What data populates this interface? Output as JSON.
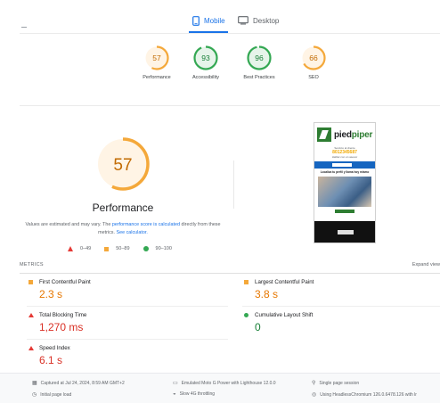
{
  "tabs": {
    "mobile": "Mobile",
    "desktop": "Desktop",
    "active": "mobile"
  },
  "scores": [
    {
      "label": "Performance",
      "value": 57,
      "color": "#f4a83a"
    },
    {
      "label": "Accessibility",
      "value": 93,
      "color": "#34a853"
    },
    {
      "label": "Best Practices",
      "value": 96,
      "color": "#34a853"
    },
    {
      "label": "SEO",
      "value": 66,
      "color": "#f4a83a"
    }
  ],
  "performance": {
    "score": 57,
    "title": "Performance",
    "note_prefix": "Values are estimated and may vary. The ",
    "note_link": "performance score is calculated",
    "note_middle": " directly from these metrics. ",
    "note_link2": "See calculator.",
    "legend": {
      "poor": "0–49",
      "average": "50–89",
      "good": "90–100"
    }
  },
  "screenshot": {
    "brand_a": "pied",
    "brand_b": "piper",
    "small_text": "Servicio al cliente",
    "phone_text": "8012345687",
    "tiny_text": "Hablar con un asesor",
    "headline": "Localiza tu perfil y llama hoy mismo"
  },
  "metrics": {
    "title": "METRICS",
    "expand": "Expand view",
    "items": [
      {
        "name": "First Contentful Paint",
        "value": "2.3 s",
        "status": "average"
      },
      {
        "name": "Largest Contentful Paint",
        "value": "3.8 s",
        "status": "average"
      },
      {
        "name": "Total Blocking Time",
        "value": "1,270 ms",
        "status": "poor"
      },
      {
        "name": "Cumulative Layout Shift",
        "value": "0",
        "status": "good"
      },
      {
        "name": "Speed Index",
        "value": "6.1 s",
        "status": "poor"
      }
    ]
  },
  "footer": {
    "captured": "Captured at Jul 24, 2024, 8:59 AM GMT+2",
    "initial_load": "Initial page load",
    "emulated": "Emulated Moto G Power with Lighthouse 12.0.0",
    "throttling": "Slow 4G throttling",
    "session": "Single page session",
    "browser": "Using HeadlessChromium 126.0.6478.126 with lr"
  }
}
